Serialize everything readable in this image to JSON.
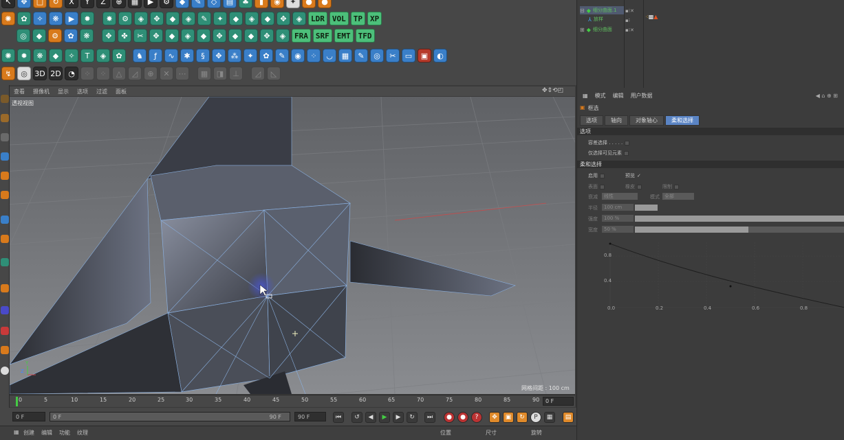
{
  "toolbar": {
    "row3_labels": [
      "LDR",
      "VOL",
      "TP",
      "XP"
    ],
    "row4_labels": [
      "FRA",
      "SRF",
      "EMT",
      "TFD"
    ]
  },
  "viewport": {
    "menu": [
      "查看",
      "摄像机",
      "显示",
      "选项",
      "过滤",
      "面板"
    ],
    "label": "透视视图",
    "grid_distance": "网格间距 : 100 cm"
  },
  "timeline": {
    "ticks": [
      "0",
      "5",
      "10",
      "15",
      "20",
      "25",
      "30",
      "35",
      "40",
      "45",
      "50",
      "55",
      "60",
      "65",
      "70",
      "75",
      "80",
      "85",
      "90"
    ],
    "current_frame": "0 F",
    "start_field": "0 F",
    "range_start": "0 F",
    "range_end": "90 F",
    "end_field": "90 F"
  },
  "bottom_bar": {
    "menu": [
      "创建",
      "编辑",
      "功能",
      "纹理"
    ],
    "coords_headers": [
      "位置",
      "尺寸",
      "旋转"
    ]
  },
  "objects": {
    "items": [
      {
        "name": "细分曲面.1",
        "selected": true
      },
      {
        "name": "放样",
        "selected": false
      },
      {
        "name": "细分曲面",
        "selected": false
      }
    ]
  },
  "attributes": {
    "header_menu": [
      "模式",
      "编辑",
      "用户数据"
    ],
    "tool_name": "框选",
    "tabs": [
      "选项",
      "轴向",
      "对象轴心",
      "柔和选择"
    ],
    "active_tab": "柔和选择",
    "section_options": "选项",
    "opt_tolerant": "容差选择 . . . . .",
    "opt_visible_only": "仅选择可见元素",
    "section_soft": "柔和选择",
    "enable_label": "启用",
    "preview_label": "预览",
    "surface_label": "表面",
    "rubber_label": "橡皮",
    "restrict_label": "限制",
    "falloff_label": "衰减",
    "falloff_value": "线性",
    "mode_label": "模式",
    "mode_value": "全部",
    "radius_label": "半径",
    "radius_value": "100 cm",
    "strength_label": "强度",
    "strength_value": "100 %",
    "width_label": "宽度",
    "width_value": "50 %",
    "curve_y_ticks": [
      "0.8",
      "0.4"
    ],
    "curve_x_ticks": [
      "0.0",
      "0.2",
      "0.4",
      "0.6",
      "0.8"
    ],
    "strength_level": 1.0,
    "width_level": 0.5
  }
}
